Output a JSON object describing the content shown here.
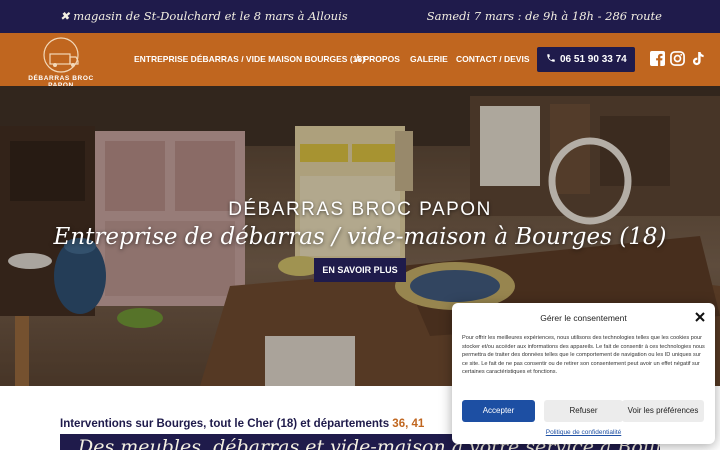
{
  "topbar": {
    "left_text": "✖ magasin de St-Doulchard et le 8 mars à Allouis",
    "right_text": "Samedi 7 mars : de 9h à 18h - 286 route"
  },
  "logo": {
    "text": "DÉBARRAS BROC PAPON"
  },
  "nav": {
    "items": [
      {
        "label": "ENTREPRISE DÉBARRAS / VIDE MAISON BOURGES (18)"
      },
      {
        "label": "À PROPOS"
      },
      {
        "label": "GALERIE"
      },
      {
        "label": "CONTACT / DEVIS"
      }
    ],
    "phone": "06 51 90 33 74"
  },
  "social": {
    "icons": [
      "facebook-icon",
      "instagram-icon",
      "tiktok-icon"
    ]
  },
  "hero": {
    "title": "DÉBARRAS BROC PAPON",
    "subtitle": "Entreprise de débarras / vide-maison à Bourges (18)",
    "button": "EN SAVOIR PLUS"
  },
  "intro": {
    "text": "Interventions sur Bourges, tout le Cher (18) et départements ",
    "highlight": "36, 41"
  },
  "band": {
    "text": "Des meubles, débarras et vide-maison à votre service à Bourges et"
  },
  "consent": {
    "title": "Gérer le consentement",
    "body": "Pour offrir les meilleures expériences, nous utilisons des technologies telles que les cookies pour stocker et/ou accéder aux informations des appareils. Le fait de consentir à ces technologies nous permettra de traiter des données telles que le comportement de navigation ou les ID uniques sur ce site. Le fait de ne pas consentir ou de retirer son consentement peut avoir un effet négatif sur certaines caractéristiques et fonctions.",
    "accept": "Accepter",
    "refuse": "Refuser",
    "prefs": "Voir les préférences",
    "policy": "Politique de confidentialité"
  },
  "colors": {
    "navy": "#1f1b4b",
    "orange": "#c0661f",
    "accent_blue": "#1d4fa3"
  }
}
